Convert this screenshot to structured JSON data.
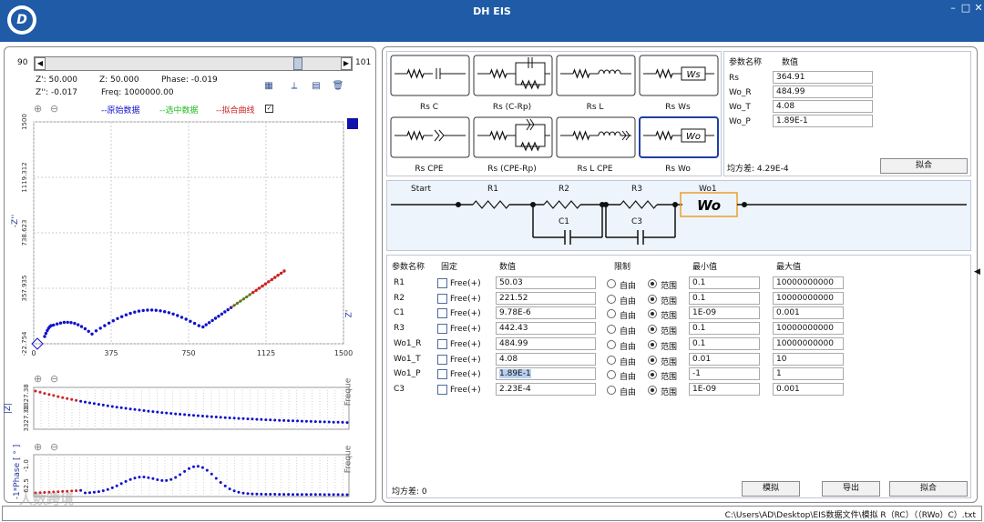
{
  "app": {
    "title": "DH EIS",
    "logo_letter": "D"
  },
  "left": {
    "scroll_min": "90",
    "scroll_max": "101",
    "readout": {
      "zre": "Z': 50.000",
      "zmag": "Z: 50.000",
      "phase": "Phase: -0.019",
      "zim": "Z'': -0.017",
      "freq": "Freq: 1000000.00"
    },
    "legend": {
      "raw": "--原始数据",
      "sel": "--选中数据",
      "fit": "--拟合曲线",
      "checked": true
    },
    "nyquist": {
      "ylabel": "-Z''",
      "xlabel_right": "Z'",
      "xticks": [
        "0",
        "375",
        "750",
        "1125",
        "1500"
      ],
      "yticks": [
        "-22.754",
        "357.935",
        "738.623",
        "1119.312",
        "1500"
      ]
    },
    "bode_mag": {
      "ylabel": "|Z|",
      "yticks": [
        "-1327.38",
        "3327.38"
      ],
      "xlabel_right": "Freque"
    },
    "bode_phase": {
      "ylabel": "-1*Phase [ ° ]",
      "yticks": [
        "-1.0",
        "62.5"
      ],
      "xlabel_right": "Freque"
    }
  },
  "circuits": [
    {
      "label": "Rs C"
    },
    {
      "label": "Rs (C-Rp)"
    },
    {
      "label": "Rs L"
    },
    {
      "label": "Rs Ws"
    },
    {
      "label": "Rs CPE"
    },
    {
      "label": "Rs (CPE-Rp)"
    },
    {
      "label": "Rs L CPE"
    },
    {
      "label": "Rs Wo"
    }
  ],
  "quick_params": {
    "header_name": "参数名称",
    "header_value": "数值",
    "rows": [
      {
        "name": "Rs",
        "value": "364.91"
      },
      {
        "name": "Wo_R",
        "value": "484.99"
      },
      {
        "name": "Wo_T",
        "value": "4.08"
      },
      {
        "name": "Wo_P",
        "value": "1.89E-1"
      }
    ],
    "variance": "均方差:  4.29E-4",
    "fit_button": "拟合"
  },
  "circuit_diagram": {
    "start": "Start",
    "labels": [
      "R1",
      "R2",
      "R3",
      "Wo1",
      "C1",
      "C3"
    ]
  },
  "params": {
    "headers": {
      "name": "参数名称",
      "fixed": "固定",
      "value": "数值",
      "limit": "限制",
      "min": "最小值",
      "max": "最大值"
    },
    "rows": [
      {
        "name": "R1",
        "fixed": "Free(+)",
        "value": "50.03",
        "free": "自由",
        "range": "范围",
        "min": "0.1",
        "max": "10000000000"
      },
      {
        "name": "R2",
        "fixed": "Free(+)",
        "value": "221.52",
        "free": "自由",
        "range": "范围",
        "min": "0.1",
        "max": "10000000000"
      },
      {
        "name": "C1",
        "fixed": "Free(+)",
        "value": "9.78E-6",
        "free": "自由",
        "range": "范围",
        "min": "1E-09",
        "max": "0.001"
      },
      {
        "name": "R3",
        "fixed": "Free(+)",
        "value": "442.43",
        "free": "自由",
        "range": "范围",
        "min": "0.1",
        "max": "10000000000"
      },
      {
        "name": "Wo1_R",
        "fixed": "Free(+)",
        "value": "484.99",
        "free": "自由",
        "range": "范围",
        "min": "0.1",
        "max": "10000000000"
      },
      {
        "name": "Wo1_T",
        "fixed": "Free(+)",
        "value": "4.08",
        "free": "自由",
        "range": "范围",
        "min": "0.01",
        "max": "10"
      },
      {
        "name": "Wo1_P",
        "fixed": "Free(+)",
        "value": "1.89E-1",
        "free": "自由",
        "range": "范围",
        "min": "-1",
        "max": "1"
      },
      {
        "name": "C3",
        "fixed": "Free(+)",
        "value": "2.23E-4",
        "free": "自由",
        "range": "范围",
        "min": "1E-09",
        "max": "0.001"
      }
    ],
    "variance": "均方差:  0",
    "buttons": {
      "simulate": "模拟",
      "export": "导出",
      "fit": "拟合"
    }
  },
  "status": {
    "path": "C:\\Users\\AD\\Desktop\\EIS数据文件\\模拟 R（RC）（（RWo）C）.txt"
  },
  "watermark": "人数跨境",
  "colors": {
    "title_bar": "#1f5ba6",
    "raw": "#1010cc",
    "selected": "#22bb22",
    "fit": "#cc2222"
  }
}
